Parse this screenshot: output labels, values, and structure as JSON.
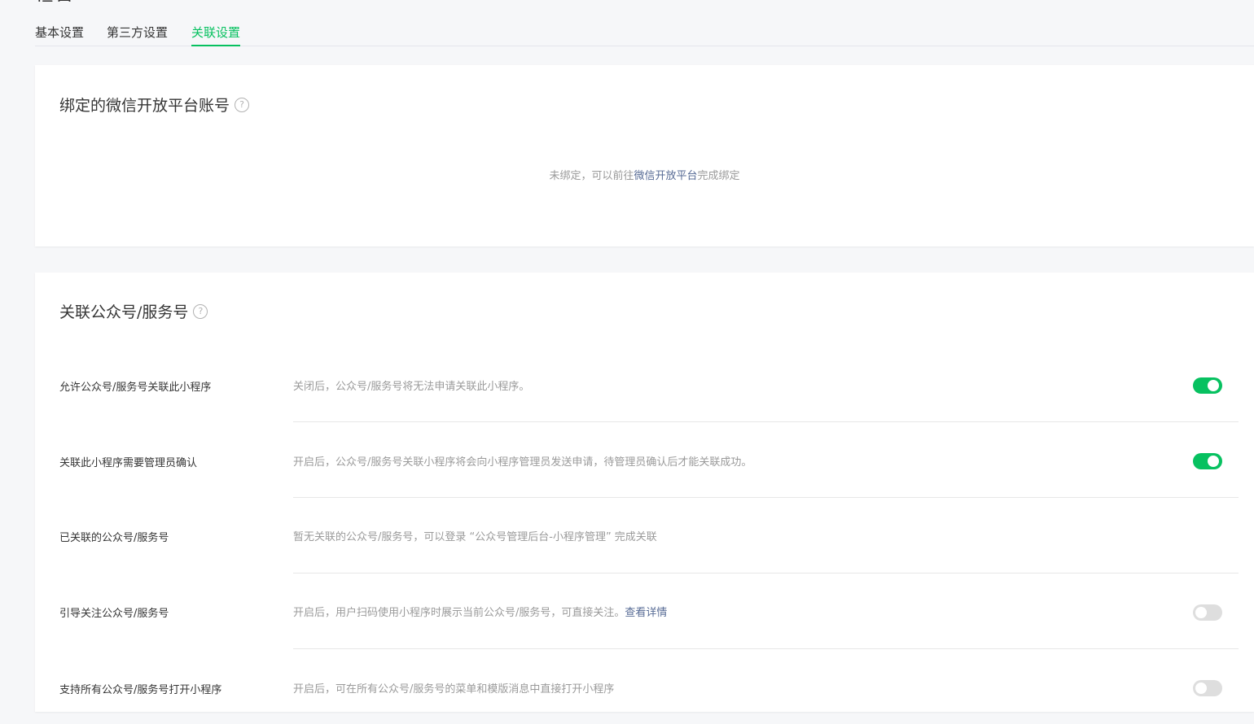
{
  "page": {
    "heading_partial": "设置"
  },
  "tabs": [
    {
      "label": "基本设置",
      "active": false
    },
    {
      "label": "第三方设置",
      "active": false
    },
    {
      "label": "关联设置",
      "active": true
    }
  ],
  "open_platform": {
    "title": "绑定的微信开放平台账号",
    "help_icon": "?",
    "empty_prefix": "未绑定，可以前往",
    "empty_link": "微信开放平台",
    "empty_suffix": "完成绑定"
  },
  "linked_accounts": {
    "title": "关联公众号/服务号",
    "help_icon": "?",
    "rows": [
      {
        "label": "允许公众号/服务号关联此小程序",
        "desc": "关闭后，公众号/服务号将无法申请关联此小程序。",
        "toggle": "on"
      },
      {
        "label": "关联此小程序需要管理员确认",
        "desc": "开启后，公众号/服务号关联小程序将会向小程序管理员发送申请，待管理员确认后才能关联成功。",
        "toggle": "on"
      },
      {
        "label": "已关联的公众号/服务号",
        "desc": "暂无关联的公众号/服务号，可以登录 “公众号管理后台-小程序管理” 完成关联"
      },
      {
        "label": "引导关注公众号/服务号",
        "desc": "开启后，用户扫码使用小程序时展示当前公众号/服务号，可直接关注。",
        "link": "查看详情",
        "toggle": "off"
      },
      {
        "label": "支持所有公众号/服务号打开小程序",
        "desc": "开启后，可在所有公众号/服务号的菜单和模版消息中直接打开小程序",
        "toggle": "off"
      }
    ]
  },
  "colors": {
    "accent": "#07c160",
    "link": "#576b95",
    "toggle_off": "#dedede"
  }
}
